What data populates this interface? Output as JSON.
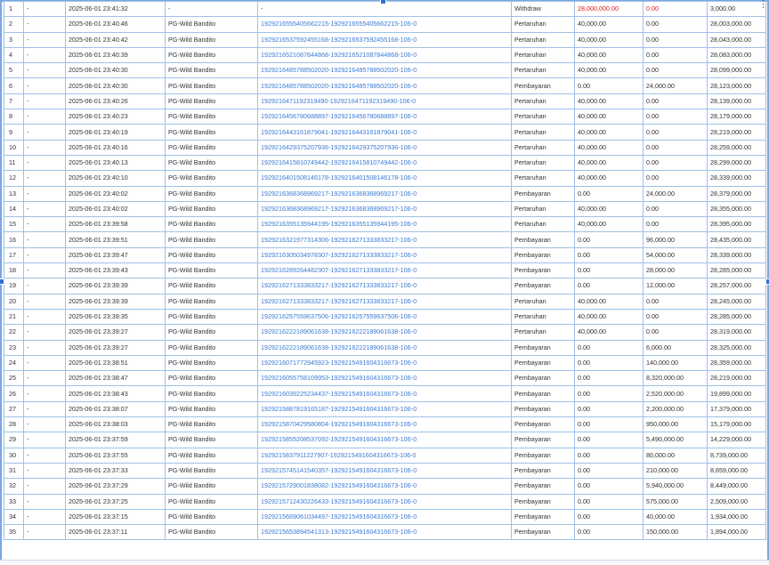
{
  "table": {
    "rows": [
      [
        "1",
        "-",
        "2025-06-01 23:41:32",
        "-",
        "-",
        "Withdraw",
        "28,000,000.00",
        "0.00",
        "3,000.00"
      ],
      [
        "2",
        "-",
        "2025-06-01 23:40:46",
        "PG-Wild Bandito",
        "1929216555405662215-1929216555405662215-106-0",
        "Pertaruhan",
        "40,000.00",
        "0.00",
        "28,003,000.00"
      ],
      [
        "3",
        "-",
        "2025-06-01 23:40:42",
        "PG-Wild Bandito",
        "1929216537592455168-1929216537592455168-106-0",
        "Pertaruhan",
        "40,000.00",
        "0.00",
        "28,043,000.00"
      ],
      [
        "4",
        "-",
        "2025-06-01 23:40:39",
        "PG-Wild Bandito",
        "1929216521087844868-1929216521087844868-106-0",
        "Pertaruhan",
        "40,000.00",
        "0.00",
        "28,083,000.00"
      ],
      [
        "5",
        "-",
        "2025-06-01 23:40:30",
        "PG-Wild Bandito",
        "1929216485788502020-1929216485788502020-106-0",
        "Pertaruhan",
        "40,000.00",
        "0.00",
        "28,099,000.00"
      ],
      [
        "6",
        "-",
        "2025-06-01 23:40:30",
        "PG-Wild Bandito",
        "1929216485788502020-1929216485788502020-106-0",
        "Pembayaran",
        "0.00",
        "24,000.00",
        "28,123,000.00"
      ],
      [
        "7",
        "-",
        "2025-06-01 23:40:26",
        "PG-Wild Bandito",
        "1929216471192319490-1929216471192319490-106-0",
        "Pertaruhan",
        "40,000.00",
        "0.00",
        "28,139,000.00"
      ],
      [
        "8",
        "-",
        "2025-06-01 23:40:23",
        "PG-Wild Bandito",
        "1929216456780688897-1929216456780688897-106-0",
        "Pertaruhan",
        "40,000.00",
        "0.00",
        "28,179,000.00"
      ],
      [
        "9",
        "-",
        "2025-06-01 23:40:19",
        "PG-Wild Bandito",
        "1929216443161879041-1929216443161879041-106-0",
        "Pertaruhan",
        "40,000.00",
        "0.00",
        "28,219,000.00"
      ],
      [
        "10",
        "-",
        "2025-06-01 23:40:16",
        "PG-Wild Bandito",
        "1929216429375207936-1929216429375207936-106-0",
        "Pertaruhan",
        "40,000.00",
        "0.00",
        "28,259,000.00"
      ],
      [
        "11",
        "-",
        "2025-06-01 23:40:13",
        "PG-Wild Bandito",
        "1929216415810749442-1929216415810749442-106-0",
        "Pertaruhan",
        "40,000.00",
        "0.00",
        "28,299,000.00"
      ],
      [
        "12",
        "-",
        "2025-06-01 23:40:10",
        "PG-Wild Bandito",
        "1929216401508146178-1929216401508146178-106-0",
        "Pertaruhan",
        "40,000.00",
        "0.00",
        "28,339,000.00"
      ],
      [
        "13",
        "-",
        "2025-06-01 23:40:02",
        "PG-Wild Bandito",
        "1929216368368969217-1929216368368969217-106-0",
        "Pembayaran",
        "0.00",
        "24,000.00",
        "28,379,000.00"
      ],
      [
        "14",
        "-",
        "2025-06-01 23:40:02",
        "PG-Wild Bandito",
        "1929216368368969217-1929216368368969217-106-0",
        "Pertaruhan",
        "40,000.00",
        "0.00",
        "28,355,000.00"
      ],
      [
        "15",
        "-",
        "2025-06-01 23:39:58",
        "PG-Wild Bandito",
        "1929216355135944195-1929216355135944195-106-0",
        "Pertaruhan",
        "40,000.00",
        "0.00",
        "28,395,000.00"
      ],
      [
        "16",
        "-",
        "2025-06-01 23:39:51",
        "PG-Wild Bandito",
        "1929216321977314306-1929216271333833217-106-0",
        "Pembayaran",
        "0.00",
        "96,000.00",
        "28,435,000.00"
      ],
      [
        "17",
        "-",
        "2025-06-01 23:39:47",
        "PG-Wild Bandito",
        "1929216305034978307-1929216271333833217-106-0",
        "Pembayaran",
        "0.00",
        "54,000.00",
        "28,339,000.00"
      ],
      [
        "18",
        "-",
        "2025-06-01 23:39:43",
        "PG-Wild Bandito",
        "1929216289264482307-1929216271333833217-106-0",
        "Pembayaran",
        "0.00",
        "28,000.00",
        "28,285,000.00"
      ],
      [
        "19",
        "-",
        "2025-06-01 23:39:39",
        "PG-Wild Bandito",
        "1929216271333833217-1929216271333833217-106-0",
        "Pembayaran",
        "0.00",
        "12,000.00",
        "28,257,000.00"
      ],
      [
        "20",
        "-",
        "2025-06-01 23:39:39",
        "PG-Wild Bandito",
        "1929216271333833217-1929216271333833217-106-0",
        "Pertaruhan",
        "40,000.00",
        "0.00",
        "28,245,000.00"
      ],
      [
        "21",
        "-",
        "2025-06-01 23:39:35",
        "PG-Wild Bandito",
        "1929216257559637506-1929216257559637506-106-0",
        "Pertaruhan",
        "40,000.00",
        "0.00",
        "28,285,000.00"
      ],
      [
        "22",
        "-",
        "2025-06-01 23:39:27",
        "PG-Wild Bandito",
        "1929216222189061638-1929216222189061638-106-0",
        "Pertaruhan",
        "40,000.00",
        "0.00",
        "28,319,000.00"
      ],
      [
        "23",
        "-",
        "2025-06-01 23:39:27",
        "PG-Wild Bandito",
        "1929216222189061638-1929216222189061638-106-0",
        "Pembayaran",
        "0.00",
        "6,000.00",
        "28,325,000.00"
      ],
      [
        "24",
        "-",
        "2025-06-01 23:38:51",
        "PG-Wild Bandito",
        "1929216071772945923-1929215491604316673-106-0",
        "Pembayaran",
        "0.00",
        "140,000.00",
        "28,359,000.00"
      ],
      [
        "25",
        "-",
        "2025-06-01 23:38:47",
        "PG-Wild Bandito",
        "1929216055758109953-1929215491604316673-106-0",
        "Pembayaran",
        "0.00",
        "8,320,000.00",
        "28,219,000.00"
      ],
      [
        "26",
        "-",
        "2025-06-01 23:38:43",
        "PG-Wild Bandito",
        "1929216039225234437-1929215491604316673-106-0",
        "Pembayaran",
        "0.00",
        "2,520,000.00",
        "19,899,000.00"
      ],
      [
        "27",
        "-",
        "2025-06-01 23:38:07",
        "PG-Wild Bandito",
        "1929215887819165187-1929215491604316673-106-0",
        "Pembayaran",
        "0.00",
        "2,200,000.00",
        "17,379,000.00"
      ],
      [
        "28",
        "-",
        "2025-06-01 23:38:03",
        "PG-Wild Bandito",
        "1929215870429580804-1929215491604316673-106-0",
        "Pembayaran",
        "0.00",
        "950,000.00",
        "15,179,000.00"
      ],
      [
        "29",
        "-",
        "2025-06-01 23:37:59",
        "PG-Wild Bandito",
        "1929215855208537092-1929215491604316673-106-0",
        "Pembayaran",
        "0.00",
        "5,490,000.00",
        "14,229,000.00"
      ],
      [
        "30",
        "-",
        "2025-06-01 23:37:55",
        "PG-Wild Bandito",
        "1929215837911227907-1929215491604316673-106-0",
        "Pembayaran",
        "0.00",
        "80,000.00",
        "8,739,000.00"
      ],
      [
        "31",
        "-",
        "2025-06-01 23:37:33",
        "PG-Wild Bandito",
        "1929215745141540357-1929215491604316673-106-0",
        "Pembayaran",
        "0.00",
        "210,000.00",
        "8,659,000.00"
      ],
      [
        "32",
        "-",
        "2025-06-01 23:37:29",
        "PG-Wild Bandito",
        "1929215729001838082-1929215491604316673-106-0",
        "Pembayaran",
        "0.00",
        "5,940,000.00",
        "8,449,000.00"
      ],
      [
        "33",
        "-",
        "2025-06-01 23:37:25",
        "PG-Wild Bandito",
        "1929215712430226433-1929215491604316673-106-0",
        "Pembayaran",
        "0.00",
        "575,000.00",
        "2,509,000.00"
      ],
      [
        "34",
        "-",
        "2025-06-01 23:37:15",
        "PG-Wild Bandito",
        "1929215669061034497-1929215491604316673-106-0",
        "Pembayaran",
        "0.00",
        "40,000.00",
        "1,934,000.00"
      ],
      [
        "35",
        "-",
        "2025-06-01 23:37:11",
        "PG-Wild Bandito",
        "1929215653894541313-1929215491604316673-106-0",
        "Pembayaran",
        "0.00",
        "150,000.00",
        "1,894,000.00"
      ]
    ]
  },
  "menu": {
    "icon": "more-vertical-icon",
    "glyph": "⋮"
  },
  "colors": {
    "link": "#3a7bd5",
    "highlight": "#e02020",
    "grid_border": "#9ec1e8",
    "selection": "#2f6fd0"
  }
}
